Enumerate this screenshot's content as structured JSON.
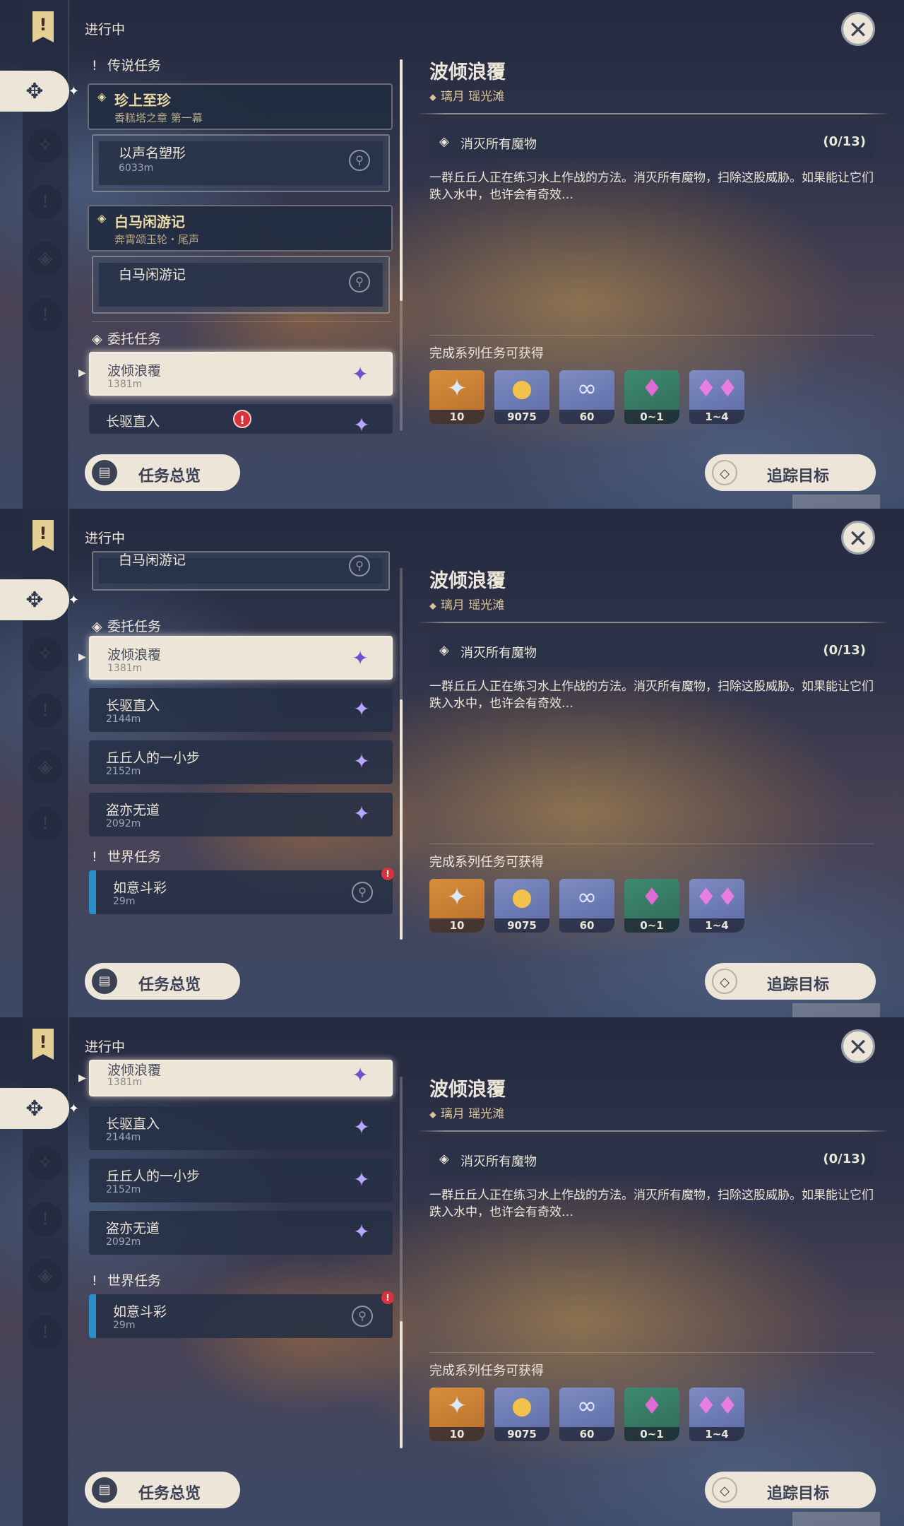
{
  "header": {
    "status": "进行中",
    "bookmark_icon": "!"
  },
  "sections": {
    "legend": "传说任务",
    "commission": "委托任务",
    "world": "世界任务"
  },
  "legend_quests": [
    {
      "title": "珍上至珍",
      "subtitle": "香糕塔之章 第一幕",
      "step": "以声名塑形",
      "distance": "6033m"
    },
    {
      "title": "白马闲游记",
      "subtitle": "奔霄颂玉轮・尾声",
      "step": "白马闲游记"
    }
  ],
  "commissions": [
    {
      "title": "波倾浪覆",
      "distance": "1381m"
    },
    {
      "title": "长驱直入",
      "distance": "2144m"
    },
    {
      "title": "丘丘人的一小步",
      "distance": "2152m"
    },
    {
      "title": "盗亦无道",
      "distance": "2092m"
    }
  ],
  "world_quests": [
    {
      "title": "如意斗彩",
      "distance": "29m"
    }
  ],
  "detail": {
    "title": "波倾浪覆",
    "location": "璃月 瑶光滩",
    "objective": "消灭所有魔物",
    "progress": "(0/13)",
    "description": "一群丘丘人正在练习水上作战的方法。消灭所有魔物，扫除这股威胁。如果能让它们跌入水中，也许会有奇效…",
    "rewards_title": "完成系列任务可获得",
    "rewards": [
      {
        "name": "primogem-icon",
        "count": "10"
      },
      {
        "name": "mora-icon",
        "count": "9075"
      },
      {
        "name": "adventure-exp-icon",
        "count": "60"
      },
      {
        "name": "crystal-chunk-icon",
        "count": "0~1"
      },
      {
        "name": "crystal-cluster-icon",
        "count": "1~4"
      }
    ]
  },
  "buttons": {
    "overview": "任务总览",
    "track": "追踪目标"
  }
}
